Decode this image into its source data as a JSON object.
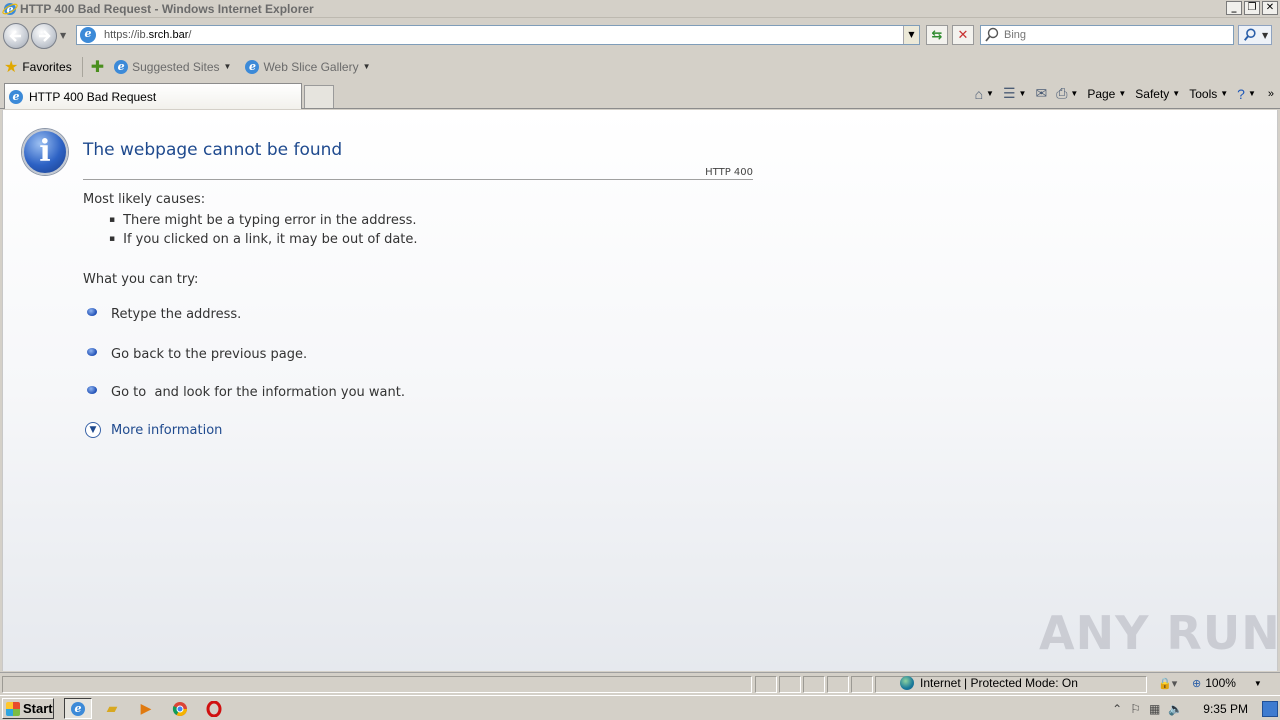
{
  "window": {
    "title": "HTTP 400 Bad Request - Windows Internet Explorer",
    "controls": [
      "minimize",
      "restore",
      "close"
    ]
  },
  "address_bar": {
    "url_prefix": "https://ib.",
    "url_domain": "srch.bar",
    "url_suffix": "/"
  },
  "search": {
    "placeholder": "Bing"
  },
  "favorites_bar": {
    "favorites_label": "Favorites",
    "suggested_sites": "Suggested Sites",
    "web_slice_gallery": "Web Slice Gallery"
  },
  "tabs": [
    {
      "label": "HTTP 400 Bad Request",
      "active": true
    }
  ],
  "command_bar": {
    "page": "Page",
    "safety": "Safety",
    "tools": "Tools",
    "more": "»"
  },
  "error_page": {
    "heading": "The webpage cannot be found",
    "code": "HTTP 400",
    "causes_title": "Most likely causes:",
    "causes": [
      "There might be a typing error in the address.",
      "If you clicked on a link, it may be out of date."
    ],
    "try_title": "What you can try:",
    "try_items": [
      "Retype the address.",
      "Go back to the previous page.",
      "Go to  and look for the information you want."
    ],
    "more_info": "More information"
  },
  "watermark": "ANY RUN",
  "status_bar": {
    "zone": "Internet | Protected Mode: On",
    "zoom": "100%"
  },
  "taskbar": {
    "start": "Start",
    "clock": "9:35 PM"
  },
  "colors": {
    "heading": "#1f4a8e",
    "link": "#1f4a8e",
    "chrome": "#d4d0c8"
  }
}
